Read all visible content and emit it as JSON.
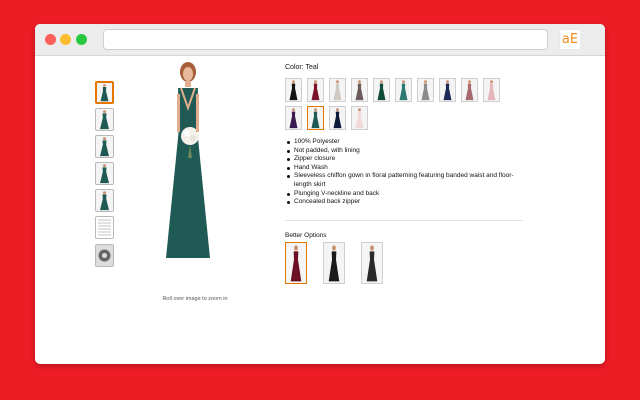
{
  "browser": {
    "url": "",
    "extension_label": "aE"
  },
  "product": {
    "main_image_color": "#1f5a55",
    "zoom_hint": "Roll over image to zoom in",
    "thumbnails": [
      {
        "name": "thumb-teal-front",
        "color": "#1f5a55",
        "selected": true
      },
      {
        "name": "thumb-teal-side",
        "color": "#1f5a55",
        "selected": false
      },
      {
        "name": "thumb-teal-back",
        "color": "#1f5a55",
        "selected": false
      },
      {
        "name": "thumb-teal-detail",
        "color": "#1f5a55",
        "selected": false
      },
      {
        "name": "thumb-teal-closeup",
        "color": "#1f5a55",
        "selected": false
      },
      {
        "name": "thumb-size-chart",
        "color": "#eeeeee",
        "selected": false
      },
      {
        "name": "thumb-360-view",
        "color": "#666666",
        "selected": false
      }
    ]
  },
  "color_selector": {
    "label": "Color: Teal",
    "swatches": [
      {
        "color": "#111111",
        "selected": false
      },
      {
        "color": "#7a1029",
        "selected": false
      },
      {
        "color": "#cfc9c2",
        "selected": false
      },
      {
        "color": "#6b5a5a",
        "selected": false
      },
      {
        "color": "#0f4d3a",
        "selected": false
      },
      {
        "color": "#2c7a74",
        "selected": false
      },
      {
        "color": "#8a8a8a",
        "selected": false
      },
      {
        "color": "#1d2a55",
        "selected": false
      },
      {
        "color": "#a86a6e",
        "selected": false
      },
      {
        "color": "#e4b5bb",
        "selected": false
      },
      {
        "color": "#3b1a52",
        "selected": false
      },
      {
        "color": "#1f5a55",
        "selected": true
      },
      {
        "color": "#0a1a3a",
        "selected": false
      },
      {
        "color": "#f2dada",
        "selected": false
      }
    ]
  },
  "features": [
    "100% Polyester",
    "Not padded, with lining",
    "Zipper closure",
    "Hand Wash",
    "Sleeveless chiffon gown in floral patterning featuring banded waist and floor-",
    "length skirt",
    "Plunging V-neckline and back",
    "Concealed back zipper"
  ],
  "better_options": {
    "label": "Better Options",
    "items": [
      {
        "color": "#6b0f22",
        "selected": true
      },
      {
        "color": "#1a1a1a",
        "selected": false
      },
      {
        "color": "#2a2a2a",
        "selected": false
      }
    ]
  },
  "colors": {
    "background": "#ee1c25",
    "accent": "#e77600"
  }
}
